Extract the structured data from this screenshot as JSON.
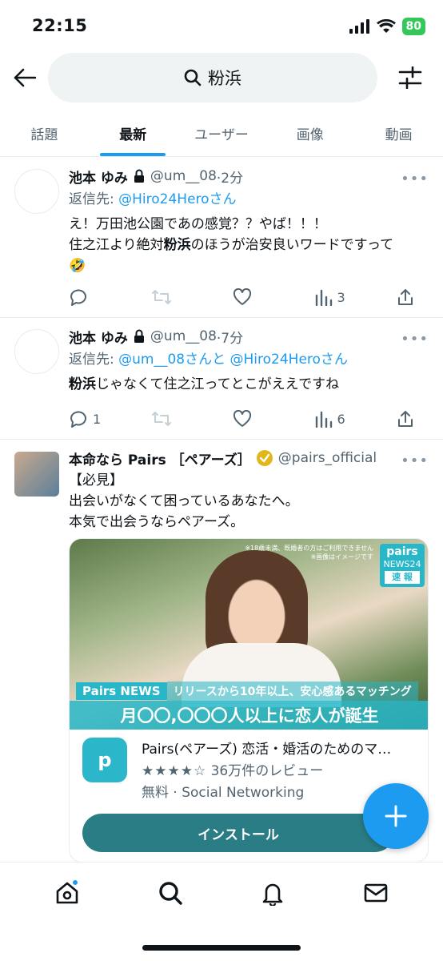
{
  "status": {
    "time": "22:15",
    "battery": "80"
  },
  "search": {
    "query": "粉浜"
  },
  "tabs": [
    {
      "label": "話題"
    },
    {
      "label": "最新"
    },
    {
      "label": "ユーザー"
    },
    {
      "label": "画像"
    },
    {
      "label": "動画"
    }
  ],
  "posts": [
    {
      "name": "池本 ゆみ",
      "handle": "@um__08",
      "time": "·2分",
      "reply_prefix": "返信先: ",
      "reply_links": "@Hiro24Heroさん",
      "line1": "え！万田池公園であの感覚？？やば！！！",
      "line2_pre": "住之江より絶対",
      "line2_bold": "粉浜",
      "line2_post": "のほうが治安良いワードですって",
      "emoji": "🤣",
      "replies": "",
      "views": "3"
    },
    {
      "name": "池本 ゆみ",
      "handle": "@um__08",
      "time": "·7分",
      "reply_prefix": "返信先: ",
      "reply_link1": "@um__08",
      "reply_mid": "さんと",
      "reply_link2": "@Hiro24Heroさん",
      "line_bold": "粉浜",
      "line_post": "じゃなくて住之江ってとこがええですね",
      "replies": "1",
      "views": "6"
    }
  ],
  "ad": {
    "name": "本命なら Pairs ［ペアーズ］",
    "handle": "@pairs_official",
    "line1": "【必見】",
    "line2": "出会いがなくて困っているあなたへ。",
    "line3": "本気で出会うならペアーズ。",
    "image": {
      "badge": "Pairs NEWS",
      "subline": "リリースから10年以上、安心感あるマッチング",
      "headline": "月〇〇,〇〇〇人以上に恋人が誕生",
      "logo_line1": "pairs",
      "logo_line2": "NEWS24",
      "logo_line3": "速 報",
      "note1": "※18歳未満、既婚者の方はご利用できません",
      "note2": "※画像はイメージです"
    },
    "app": {
      "title": "Pairs(ペアーズ) 恋活・婚活のためのマ…",
      "stars": "★★★★☆",
      "reviews": "36万件のレビュー",
      "meta": "無料 · Social Networking",
      "install": "インストール",
      "icon_letter": "p"
    }
  },
  "colors": {
    "accent": "#1d9bf0",
    "install": "#2a7d85",
    "pairs": "#27b7c9"
  }
}
